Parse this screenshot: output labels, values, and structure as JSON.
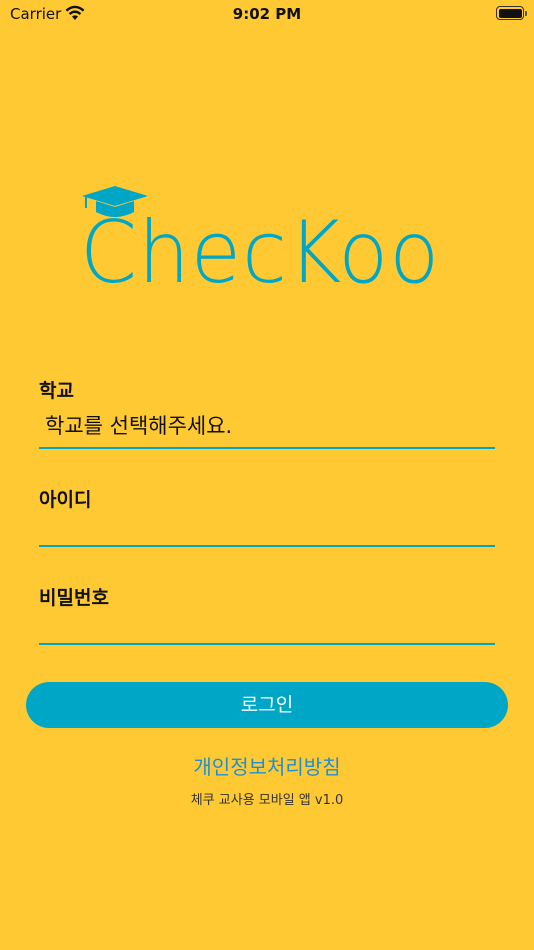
{
  "status_bar": {
    "carrier": "Carrier",
    "time": "9:02 PM",
    "wifi_icon": "wifi-icon",
    "battery_icon": "battery-icon"
  },
  "logo": {
    "text": "ChecKoo",
    "icon": "graduation-cap-icon",
    "color": "#00A6C6"
  },
  "form": {
    "school": {
      "label": "학교",
      "value": "학교를 선택해주세요."
    },
    "user_id": {
      "label": "아이디",
      "value": ""
    },
    "password": {
      "label": "비밀번호",
      "value": ""
    }
  },
  "login_button": {
    "label": "로그인"
  },
  "privacy_link": "개인정보처리방침",
  "version_text": "체쿠 교사용 모바일 앱 v1.0",
  "colors": {
    "background": "#FFC933",
    "accent": "#00A6C6",
    "link": "#1E8FD6"
  }
}
